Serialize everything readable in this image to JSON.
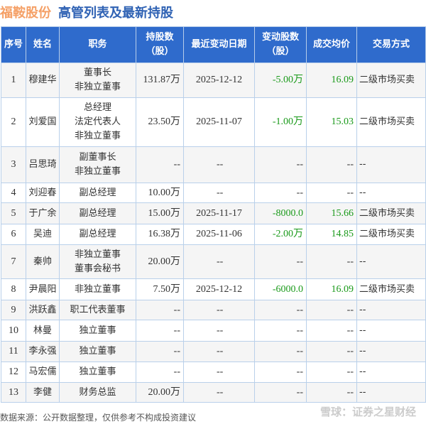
{
  "title": {
    "company": "福鞍股份",
    "subtitle": "高管列表及最新持股"
  },
  "columns": [
    "序号",
    "姓名",
    "职务",
    "持股数\n（股）",
    "最近变动日期",
    "变动股数\n（股）",
    "成交均价",
    "交易方式"
  ],
  "rows": [
    {
      "no": "1",
      "name": "穆建华",
      "position": "董事长\n非独立董事",
      "shares": "131.87万",
      "date": "2025-12-12",
      "change": "-5.00万",
      "price": "16.09",
      "method": "二级市场买卖"
    },
    {
      "no": "2",
      "name": "刘爱国",
      "position": "总经理\n法定代表人\n非独立董事",
      "shares": "23.50万",
      "date": "2025-11-07",
      "change": "-1.00万",
      "price": "15.03",
      "method": "二级市场买卖"
    },
    {
      "no": "3",
      "name": "吕思琦",
      "position": "副董事长\n非独立董事",
      "shares": "--",
      "date": "--",
      "change": "--",
      "price": "--",
      "method": "--"
    },
    {
      "no": "4",
      "name": "刘迎春",
      "position": "副总经理",
      "shares": "10.00万",
      "date": "--",
      "change": "--",
      "price": "--",
      "method": "--"
    },
    {
      "no": "5",
      "name": "于广余",
      "position": "副总经理",
      "shares": "15.00万",
      "date": "2025-11-17",
      "change": "-8000.0",
      "price": "15.66",
      "method": "二级市场买卖"
    },
    {
      "no": "6",
      "name": "吴迪",
      "position": "副总经理",
      "shares": "16.38万",
      "date": "2025-11-06",
      "change": "-2.00万",
      "price": "14.85",
      "method": "二级市场买卖"
    },
    {
      "no": "7",
      "name": "秦帅",
      "position": "非独立董事\n董事会秘书",
      "shares": "20.00万",
      "date": "--",
      "change": "--",
      "price": "--",
      "method": "--"
    },
    {
      "no": "8",
      "name": "尹晨阳",
      "position": "非独立董事",
      "shares": "7.50万",
      "date": "2025-12-12",
      "change": "-6000.0",
      "price": "16.09",
      "method": "二级市场买卖"
    },
    {
      "no": "9",
      "name": "洪跃鑫",
      "position": "职工代表董事",
      "shares": "--",
      "date": "--",
      "change": "--",
      "price": "--",
      "method": "--"
    },
    {
      "no": "10",
      "name": "林曼",
      "position": "独立董事",
      "shares": "--",
      "date": "--",
      "change": "--",
      "price": "--",
      "method": "--"
    },
    {
      "no": "11",
      "name": "李永强",
      "position": "独立董事",
      "shares": "--",
      "date": "--",
      "change": "--",
      "price": "--",
      "method": "--"
    },
    {
      "no": "12",
      "name": "马宏儒",
      "position": "独立董事",
      "shares": "--",
      "date": "--",
      "change": "--",
      "price": "--",
      "method": "--"
    },
    {
      "no": "13",
      "name": "李健",
      "position": "财务总监",
      "shares": "20.00万",
      "date": "--",
      "change": "--",
      "price": "--",
      "method": "--"
    }
  ],
  "footer": "数据来源：公开数据整理，仅供参考不构成投资建议",
  "watermark": "雪球：证券之星财经"
}
